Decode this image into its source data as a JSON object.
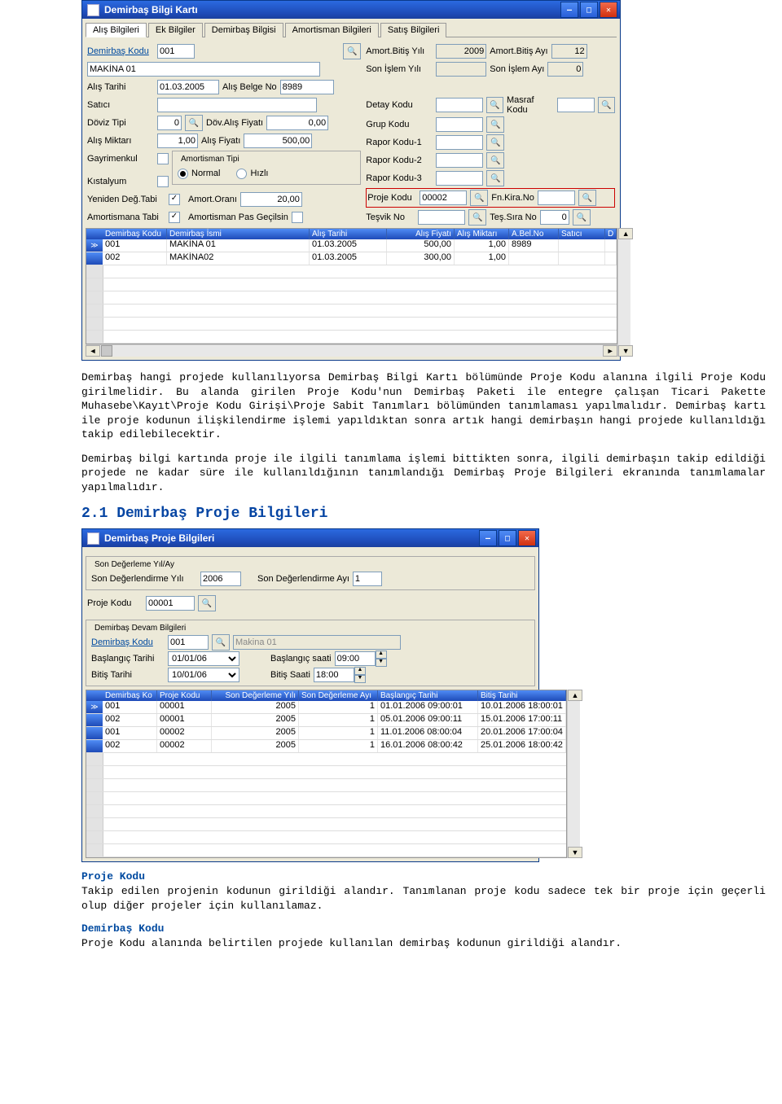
{
  "win1": {
    "title": "Demirbaş Bilgi Kartı",
    "tabs": [
      "Alış Bilgileri",
      "Ek Bilgiler",
      "Demirbaş Bilgisi",
      "Amortisman Bilgileri",
      "Satış Bilgileri"
    ],
    "left": {
      "demirbas_kodu_lab": "Demirbaş Kodu",
      "demirbas_kodu": "001",
      "name": "MAKİNA 01",
      "alis_tarihi_lab": "Alış Tarihi",
      "alis_tarihi": "01.03.2005",
      "alis_belge_lab": "Alış Belge No",
      "alis_belge": "8989",
      "satici_lab": "Satıcı",
      "satici": "",
      "doviz_tipi_lab": "Döviz Tipi",
      "doviz_tipi": "0",
      "dov_alis_lab": "Döv.Alış Fiyatı",
      "dov_alis": "0,00",
      "alis_miktari_lab": "Alış Miktarı",
      "alis_miktari": "1,00",
      "alis_fiyati_lab": "Alış Fiyatı",
      "alis_fiyati": "500,00",
      "gayrimenkul_lab": "Gayrimenkul",
      "kistalyum_lab": "Kıstalyum",
      "amort_tipi_lab": "Amortisman Tipi",
      "normal": "Normal",
      "hizli": "Hızlı",
      "yeniden_lab": "Yeniden Değ.Tabi",
      "amort_orani_lab": "Amort.Oranı",
      "amort_orani": "20,00",
      "amortismana_lab": "Amortismana Tabi",
      "amort_pas_lab": "Amortisman Pas Geçilsin"
    },
    "right": {
      "amort_bitis_yili_lab": "Amort.Bitiş Yılı",
      "amort_bitis_yili": "2009",
      "amort_bitis_ayi_lab": "Amort.Bitiş Ayı",
      "amort_bitis_ayi": "12",
      "son_islem_yili_lab": "Son İşlem Yılı",
      "son_islem_yili": "",
      "son_islem_ayi_lab": "Son İşlem Ayı",
      "son_islem_ayi": "0",
      "detay_lab": "Detay Kodu",
      "masraf_lab": "Masraf Kodu",
      "grup_lab": "Grup Kodu",
      "rapor1_lab": "Rapor Kodu-1",
      "rapor2_lab": "Rapor Kodu-2",
      "rapor3_lab": "Rapor Kodu-3",
      "proje_lab": "Proje Kodu",
      "proje_kodu": "00002",
      "fnkira_lab": "Fn.Kira.No",
      "tesvik_lab": "Teşvik No",
      "tessira_lab": "Teş.Sıra No",
      "tessira": "0"
    },
    "grid": {
      "headers": [
        "Demirbaş Kodu",
        "Demirbaş İsmi",
        "Alış Tarihi",
        "Alış Fiyatı",
        "Alış Miktarı",
        "A.Bel.No",
        "Satıcı",
        "D"
      ],
      "rows": [
        [
          "001",
          "MAKİNA 01",
          "01.03.2005",
          "500,00",
          "1,00",
          "8989",
          "",
          ""
        ],
        [
          "002",
          "MAKİNA02",
          "01.03.2005",
          "300,00",
          "1,00",
          "",
          "",
          ""
        ]
      ]
    }
  },
  "para1": "Demirbaş hangi projede kullanılıyorsa Demirbaş Bilgi Kartı bölümünde Proje Kodu alanına ilgili Proje Kodu girilmelidir. Bu alanda girilen Proje Kodu'nun Demirbaş Paketi ile entegre çalışan Ticari Pakette Muhasebe\\Kayıt\\Proje Kodu Girişi\\Proje Sabit Tanımları bölümünden tanımlaması yapılmalıdır. Demirbaş kartı ile proje kodunun ilişkilendirme işlemi yapıldıktan sonra artık hangi demirbaşın hangi projede kullanıldığı takip edilebilecektir.",
  "para2": "Demirbaş bilgi kartında proje ile ilgili tanımlama işlemi bittikten sonra, ilgili demirbaşın takip edildiği projede ne kadar süre ile kullanıldığının tanımlandığı Demirbaş Proje Bilgileri ekranında tanımlamalar yapılmalıdır.",
  "h2_1": "2.1 Demirbaş Proje Bilgileri",
  "win2": {
    "title": "Demirbaş Proje Bilgileri",
    "g1_title": "Son Değerleme Yıl/Ay",
    "sdy_lab": "Son Değerlendirme Yılı",
    "sdy": "2006",
    "sda_lab": "Son Değerlendirme Ayı",
    "sda": "1",
    "proje_lab": "Proje Kodu",
    "proje": "00001",
    "g2_title": "Demirbaş Devam Bilgileri",
    "dk_lab": "Demirbaş Kodu",
    "dk": "001",
    "dk_name": "Makina 01",
    "bast_lab": "Başlangıç Tarihi",
    "bast": "01/01/06",
    "bass_lab": "Başlangıç saati",
    "bass": "09:00",
    "bitt_lab": "Bitiş Tarihi",
    "bitt": "10/01/06",
    "bits_lab": "Bitiş Saati",
    "bits": "18:00",
    "grid": {
      "headers": [
        "Demirbaş Ko",
        "Proje Kodu",
        "Son Değerleme Yılı",
        "Son Değerleme Ayı",
        "Başlangıç Tarihi",
        "Bitiş Tarihi"
      ],
      "rows": [
        [
          "001",
          "00001",
          "2005",
          "1",
          "01.01.2006 09:00:01",
          "10.01.2006 18:00:01"
        ],
        [
          "002",
          "00001",
          "2005",
          "1",
          "05.01.2006 09:00:11",
          "15.01.2006 17:00:11"
        ],
        [
          "001",
          "00002",
          "2005",
          "1",
          "11.01.2006 08:00:04",
          "20.01.2006 17:00:04"
        ],
        [
          "002",
          "00002",
          "2005",
          "1",
          "16.01.2006 08:00:42",
          "25.01.2006 18:00:42"
        ]
      ]
    }
  },
  "lbl_proje": "Proje Kodu",
  "para3": "Takip edilen projenin kodunun girildiği alandır. Tanımlanan proje kodu sadece tek bir proje için geçerli olup diğer projeler için kullanılamaz.",
  "lbl_demirbas": "Demirbaş Kodu",
  "para4": "Proje Kodu alanında belirtilen projede kullanılan demirbaş kodunun girildiği alandır."
}
